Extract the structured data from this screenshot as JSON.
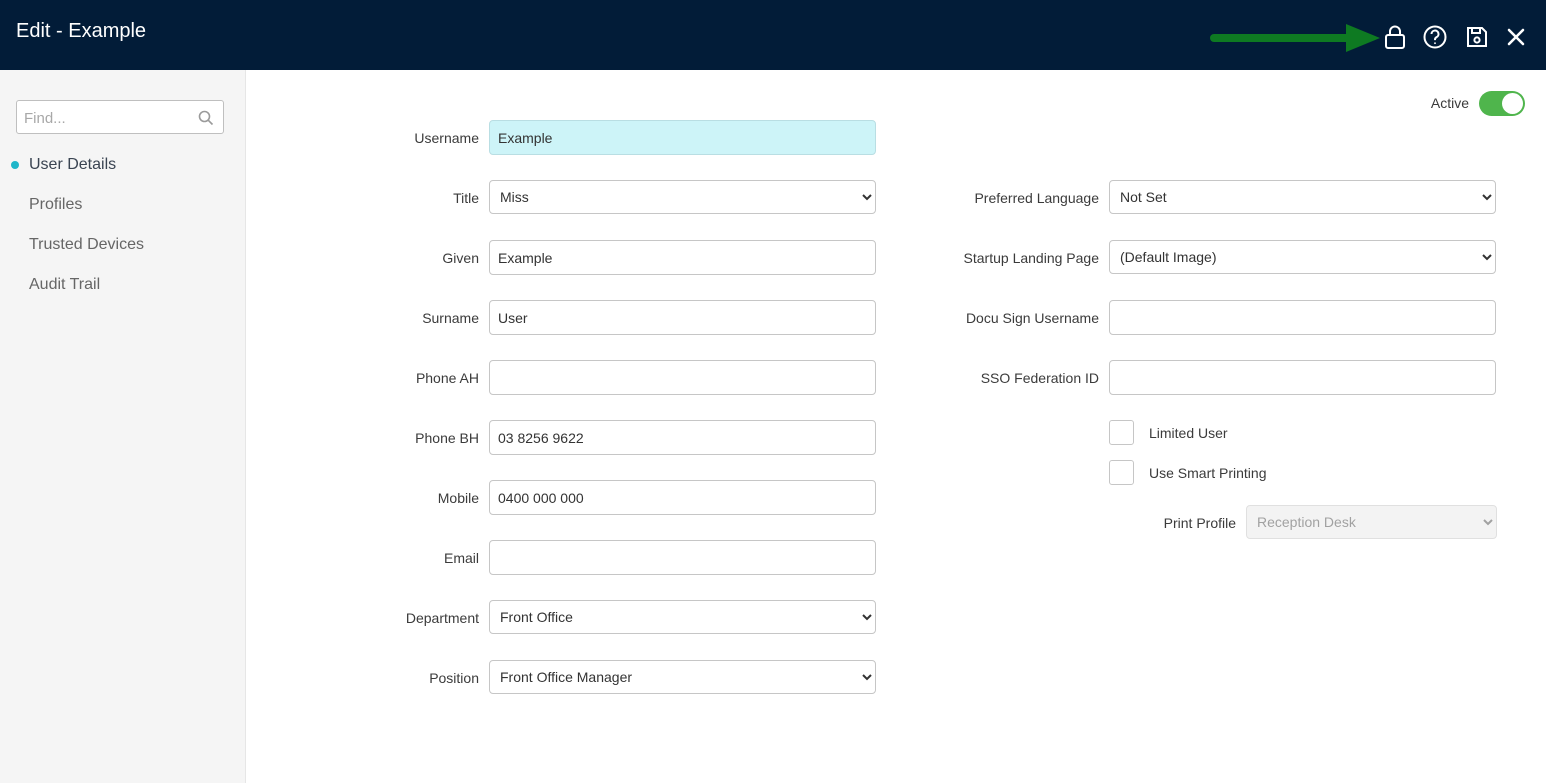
{
  "header": {
    "title": "Edit - Example",
    "icons": [
      "lock-icon",
      "help-icon",
      "save-icon",
      "close-icon"
    ],
    "arrow_color": "#0e7a22",
    "background": "#021c38"
  },
  "sidebar": {
    "search_placeholder": "Find...",
    "items": [
      {
        "label": "User Details",
        "active": true
      },
      {
        "label": "Profiles",
        "active": false
      },
      {
        "label": "Trusted Devices",
        "active": false
      },
      {
        "label": "Audit Trail",
        "active": false
      }
    ],
    "active_indicator_color": "#1fb6c9"
  },
  "status": {
    "label": "Active",
    "enabled": true,
    "color": "#4fb54c"
  },
  "form": {
    "username": {
      "label": "Username",
      "value": "Example"
    },
    "title": {
      "label": "Title",
      "value": "Miss"
    },
    "given": {
      "label": "Given",
      "value": "Example"
    },
    "surname": {
      "label": "Surname",
      "value": "User"
    },
    "phone_ah": {
      "label": "Phone AH",
      "value": ""
    },
    "phone_bh": {
      "label": "Phone BH",
      "value": "03 8256 9622"
    },
    "mobile": {
      "label": "Mobile",
      "value": "0400 000 000"
    },
    "email": {
      "label": "Email",
      "value": ""
    },
    "department": {
      "label": "Department",
      "value": "Front Office"
    },
    "position": {
      "label": "Position",
      "value": "Front Office Manager"
    },
    "preferred_language": {
      "label": "Preferred Language",
      "value": "Not Set"
    },
    "startup_landing_page": {
      "label": "Startup Landing Page",
      "value": "(Default Image)"
    },
    "docu_sign_username": {
      "label": "Docu Sign Username",
      "value": ""
    },
    "sso_federation_id": {
      "label": "SSO Federation ID",
      "value": ""
    },
    "limited_user": {
      "label": "Limited User",
      "checked": false
    },
    "use_smart_printing": {
      "label": "Use Smart Printing",
      "checked": false
    },
    "print_profile": {
      "label": "Print Profile",
      "value": "Reception Desk",
      "disabled": true
    }
  }
}
